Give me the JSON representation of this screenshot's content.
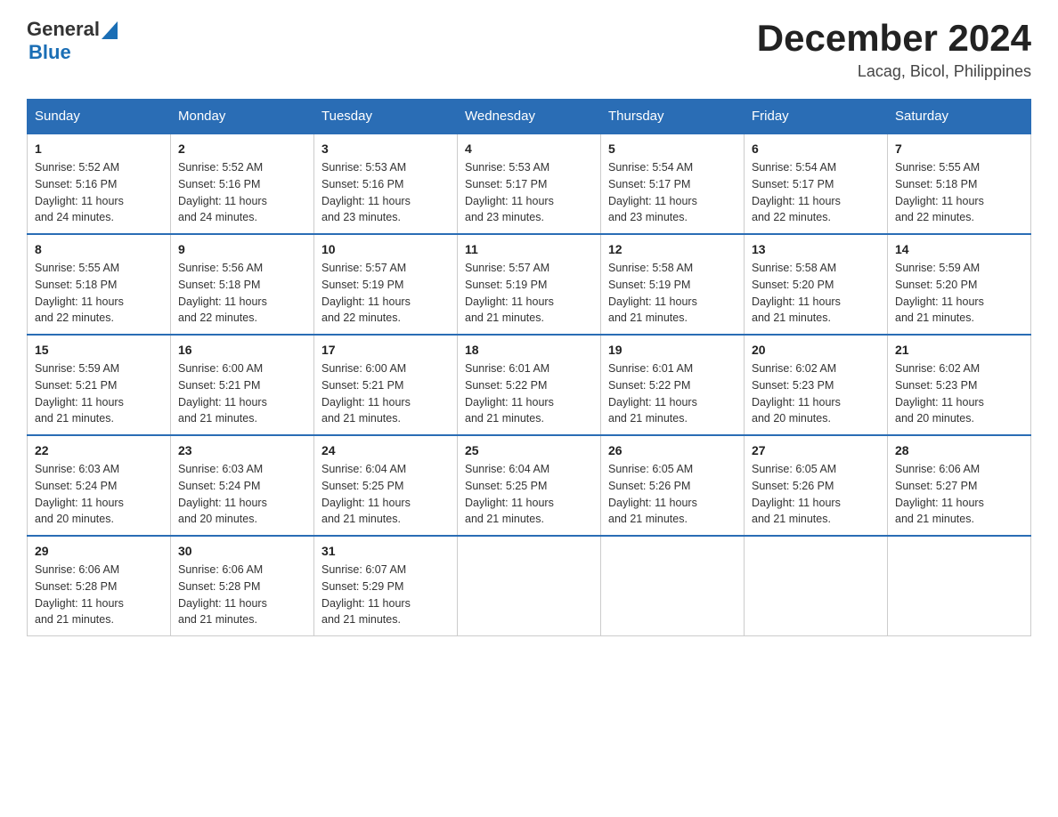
{
  "header": {
    "logo_general": "General",
    "logo_blue": "Blue",
    "month_title": "December 2024",
    "location": "Lacag, Bicol, Philippines"
  },
  "columns": [
    "Sunday",
    "Monday",
    "Tuesday",
    "Wednesday",
    "Thursday",
    "Friday",
    "Saturday"
  ],
  "weeks": [
    [
      {
        "day": "1",
        "sunrise": "5:52 AM",
        "sunset": "5:16 PM",
        "daylight": "11 hours and 24 minutes."
      },
      {
        "day": "2",
        "sunrise": "5:52 AM",
        "sunset": "5:16 PM",
        "daylight": "11 hours and 24 minutes."
      },
      {
        "day": "3",
        "sunrise": "5:53 AM",
        "sunset": "5:16 PM",
        "daylight": "11 hours and 23 minutes."
      },
      {
        "day": "4",
        "sunrise": "5:53 AM",
        "sunset": "5:17 PM",
        "daylight": "11 hours and 23 minutes."
      },
      {
        "day": "5",
        "sunrise": "5:54 AM",
        "sunset": "5:17 PM",
        "daylight": "11 hours and 23 minutes."
      },
      {
        "day": "6",
        "sunrise": "5:54 AM",
        "sunset": "5:17 PM",
        "daylight": "11 hours and 22 minutes."
      },
      {
        "day": "7",
        "sunrise": "5:55 AM",
        "sunset": "5:18 PM",
        "daylight": "11 hours and 22 minutes."
      }
    ],
    [
      {
        "day": "8",
        "sunrise": "5:55 AM",
        "sunset": "5:18 PM",
        "daylight": "11 hours and 22 minutes."
      },
      {
        "day": "9",
        "sunrise": "5:56 AM",
        "sunset": "5:18 PM",
        "daylight": "11 hours and 22 minutes."
      },
      {
        "day": "10",
        "sunrise": "5:57 AM",
        "sunset": "5:19 PM",
        "daylight": "11 hours and 22 minutes."
      },
      {
        "day": "11",
        "sunrise": "5:57 AM",
        "sunset": "5:19 PM",
        "daylight": "11 hours and 21 minutes."
      },
      {
        "day": "12",
        "sunrise": "5:58 AM",
        "sunset": "5:19 PM",
        "daylight": "11 hours and 21 minutes."
      },
      {
        "day": "13",
        "sunrise": "5:58 AM",
        "sunset": "5:20 PM",
        "daylight": "11 hours and 21 minutes."
      },
      {
        "day": "14",
        "sunrise": "5:59 AM",
        "sunset": "5:20 PM",
        "daylight": "11 hours and 21 minutes."
      }
    ],
    [
      {
        "day": "15",
        "sunrise": "5:59 AM",
        "sunset": "5:21 PM",
        "daylight": "11 hours and 21 minutes."
      },
      {
        "day": "16",
        "sunrise": "6:00 AM",
        "sunset": "5:21 PM",
        "daylight": "11 hours and 21 minutes."
      },
      {
        "day": "17",
        "sunrise": "6:00 AM",
        "sunset": "5:21 PM",
        "daylight": "11 hours and 21 minutes."
      },
      {
        "day": "18",
        "sunrise": "6:01 AM",
        "sunset": "5:22 PM",
        "daylight": "11 hours and 21 minutes."
      },
      {
        "day": "19",
        "sunrise": "6:01 AM",
        "sunset": "5:22 PM",
        "daylight": "11 hours and 21 minutes."
      },
      {
        "day": "20",
        "sunrise": "6:02 AM",
        "sunset": "5:23 PM",
        "daylight": "11 hours and 20 minutes."
      },
      {
        "day": "21",
        "sunrise": "6:02 AM",
        "sunset": "5:23 PM",
        "daylight": "11 hours and 20 minutes."
      }
    ],
    [
      {
        "day": "22",
        "sunrise": "6:03 AM",
        "sunset": "5:24 PM",
        "daylight": "11 hours and 20 minutes."
      },
      {
        "day": "23",
        "sunrise": "6:03 AM",
        "sunset": "5:24 PM",
        "daylight": "11 hours and 20 minutes."
      },
      {
        "day": "24",
        "sunrise": "6:04 AM",
        "sunset": "5:25 PM",
        "daylight": "11 hours and 21 minutes."
      },
      {
        "day": "25",
        "sunrise": "6:04 AM",
        "sunset": "5:25 PM",
        "daylight": "11 hours and 21 minutes."
      },
      {
        "day": "26",
        "sunrise": "6:05 AM",
        "sunset": "5:26 PM",
        "daylight": "11 hours and 21 minutes."
      },
      {
        "day": "27",
        "sunrise": "6:05 AM",
        "sunset": "5:26 PM",
        "daylight": "11 hours and 21 minutes."
      },
      {
        "day": "28",
        "sunrise": "6:06 AM",
        "sunset": "5:27 PM",
        "daylight": "11 hours and 21 minutes."
      }
    ],
    [
      {
        "day": "29",
        "sunrise": "6:06 AM",
        "sunset": "5:28 PM",
        "daylight": "11 hours and 21 minutes."
      },
      {
        "day": "30",
        "sunrise": "6:06 AM",
        "sunset": "5:28 PM",
        "daylight": "11 hours and 21 minutes."
      },
      {
        "day": "31",
        "sunrise": "6:07 AM",
        "sunset": "5:29 PM",
        "daylight": "11 hours and 21 minutes."
      },
      null,
      null,
      null,
      null
    ]
  ],
  "labels": {
    "sunrise": "Sunrise:",
    "sunset": "Sunset:",
    "daylight": "Daylight:"
  }
}
